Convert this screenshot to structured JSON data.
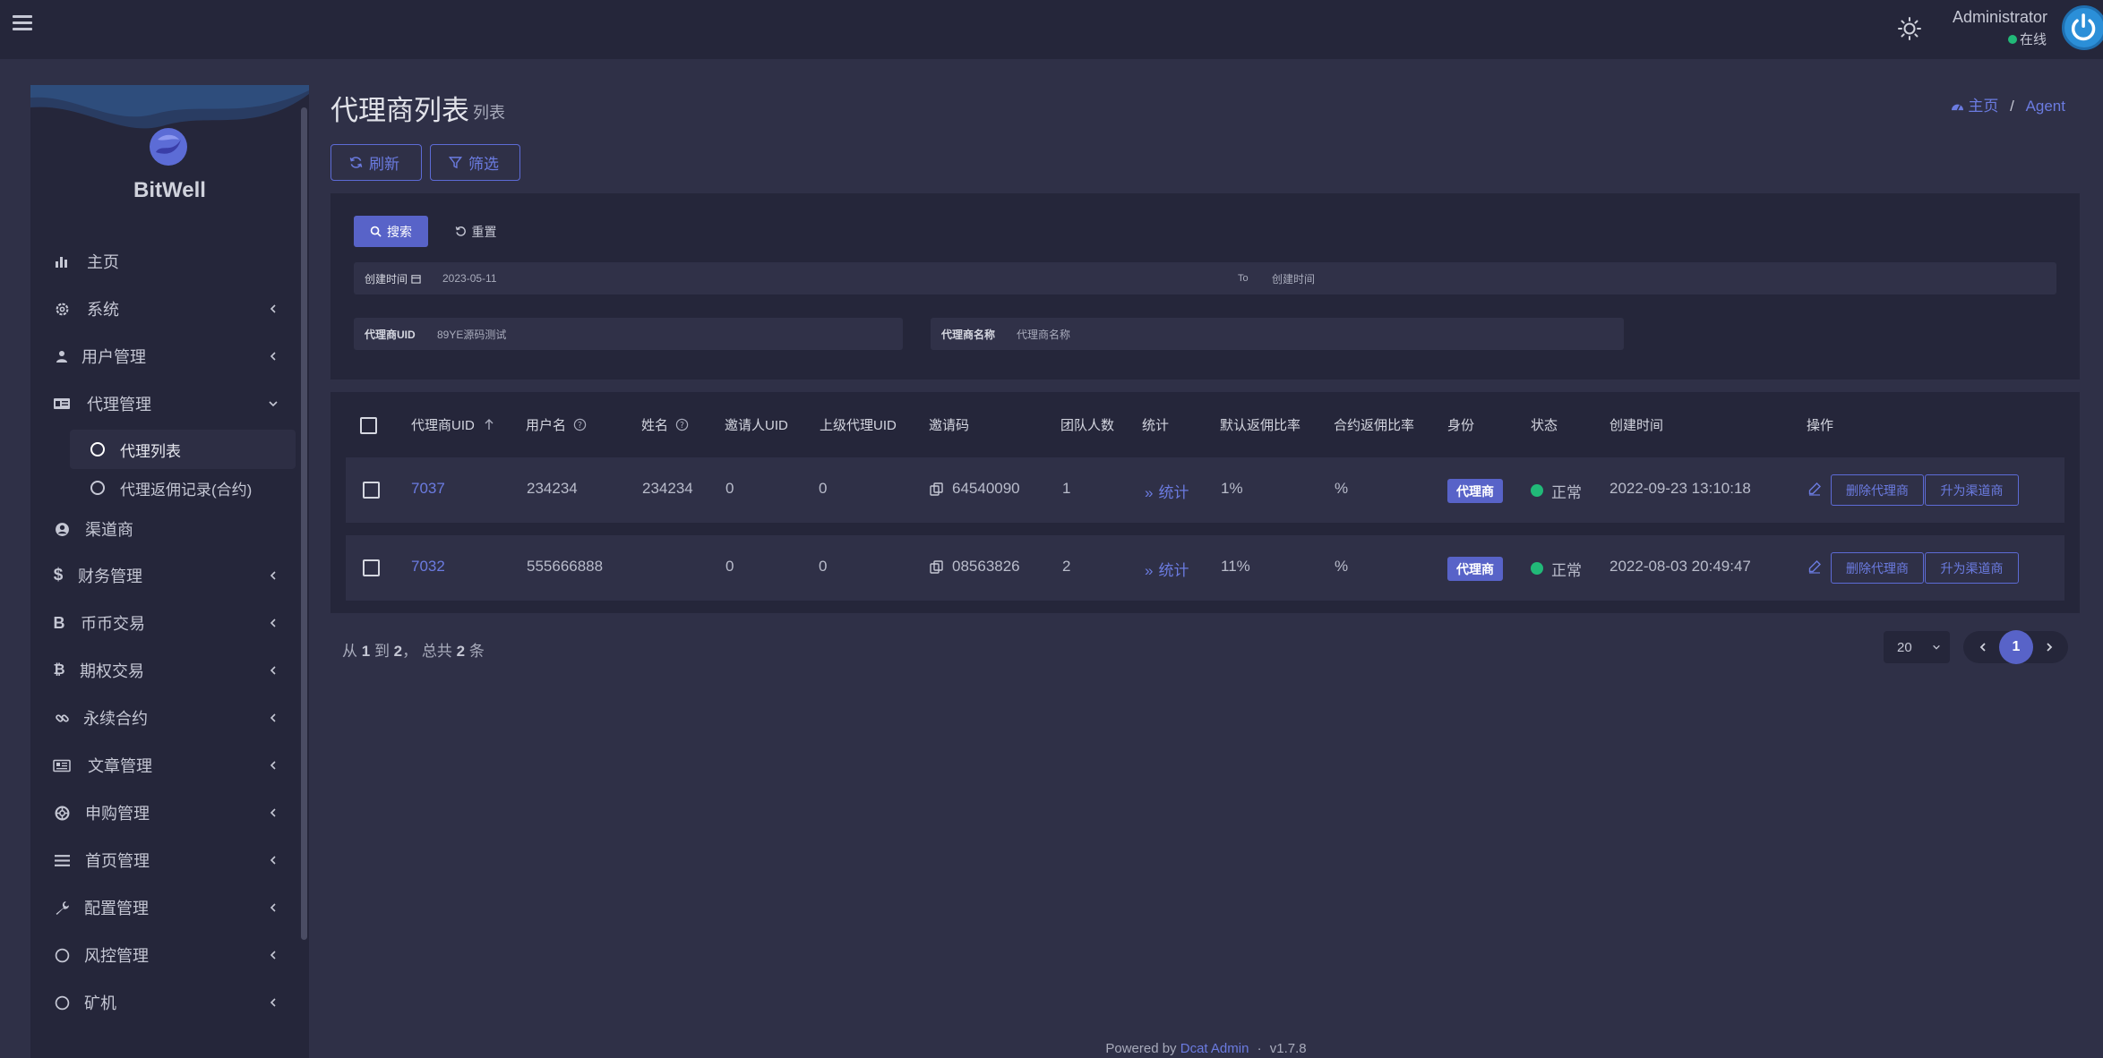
{
  "header": {
    "user_name": "Administrator",
    "user_status": "在线"
  },
  "brand": {
    "name": "BitWell"
  },
  "sidebar": {
    "items": [
      {
        "label": "主页",
        "icon": "bar-chart-icon"
      },
      {
        "label": "系统",
        "icon": "gear-icon"
      },
      {
        "label": "用户管理",
        "icon": "users-icon"
      },
      {
        "label": "代理管理",
        "icon": "id-card-icon"
      },
      {
        "label": "渠道商",
        "icon": "user-circle-icon"
      },
      {
        "label": "财务管理",
        "icon": "dollar-icon"
      },
      {
        "label": "币币交易",
        "icon": "bitcoin-b-icon"
      },
      {
        "label": "期权交易",
        "icon": "bitcoin-icon"
      },
      {
        "label": "永续合约",
        "icon": "link-icon"
      },
      {
        "label": "文章管理",
        "icon": "newspaper-icon"
      },
      {
        "label": "申购管理",
        "icon": "life-ring-icon"
      },
      {
        "label": "首页管理",
        "icon": "list-icon"
      },
      {
        "label": "配置管理",
        "icon": "wrench-icon"
      },
      {
        "label": "风控管理",
        "icon": "circle-icon"
      },
      {
        "label": "矿机",
        "icon": "circle-icon"
      }
    ],
    "sub_items": [
      {
        "label": "代理列表"
      },
      {
        "label": "代理返佣记录(合约)"
      }
    ]
  },
  "page": {
    "title": "代理商列表",
    "subtitle": "列表",
    "breadcrumb_home": "主页",
    "breadcrumb_sep": "/",
    "breadcrumb_current": "Agent",
    "refresh_label": "刷新",
    "filter_label": "筛选"
  },
  "filter": {
    "search_label": "搜索",
    "reset_label": "重置",
    "created_label": "创建时间",
    "created_from": "2023-05-11",
    "to_label": "To",
    "created_to_placeholder": "创建时间",
    "uid_label": "代理商UID",
    "uid_value": "89YE源码测试",
    "name_label": "代理商名称",
    "name_placeholder": "代理商名称"
  },
  "table": {
    "columns": [
      "代理商UID",
      "用户名",
      "姓名",
      "邀请人UID",
      "上级代理UID",
      "邀请码",
      "团队人数",
      "统计",
      "默认返佣比率",
      "合约返佣比率",
      "身份",
      "状态",
      "创建时间",
      "操作"
    ],
    "rows": [
      {
        "uid": "7037",
        "username": "234234",
        "name": "234234",
        "inviter_uid": "0",
        "parent_uid": "0",
        "invite_code": "64540090",
        "team": "1",
        "stats": "统计",
        "default_rate": "1%",
        "contract_rate": "%",
        "role": "代理商",
        "status": "正常",
        "created": "2022-09-23 13:10:18",
        "delete_label": "删除代理商",
        "upgrade_label": "升为渠道商"
      },
      {
        "uid": "7032",
        "username": "555666888",
        "name": "",
        "inviter_uid": "0",
        "parent_uid": "0",
        "invite_code": "08563826",
        "team": "2",
        "stats": "统计",
        "default_rate": "11%",
        "contract_rate": "%",
        "role": "代理商",
        "status": "正常",
        "created": "2022-08-03 20:49:47",
        "delete_label": "删除代理商",
        "upgrade_label": "升为渠道商"
      }
    ]
  },
  "pagination": {
    "info_prefix": "从",
    "from": "1",
    "info_to": "到",
    "to": "2",
    "info_total": "，  总共",
    "total": "2",
    "info_suffix": "条",
    "per_page": "20",
    "current": "1"
  },
  "footer": {
    "powered_by": "Powered by",
    "product": "Dcat Admin",
    "sep": "·",
    "version": "v1.7.8"
  },
  "colors": {
    "accent": "#5863c8",
    "link": "#6b7be0",
    "success": "#21b978",
    "background": "#2f3047",
    "panel": "#25263a"
  }
}
